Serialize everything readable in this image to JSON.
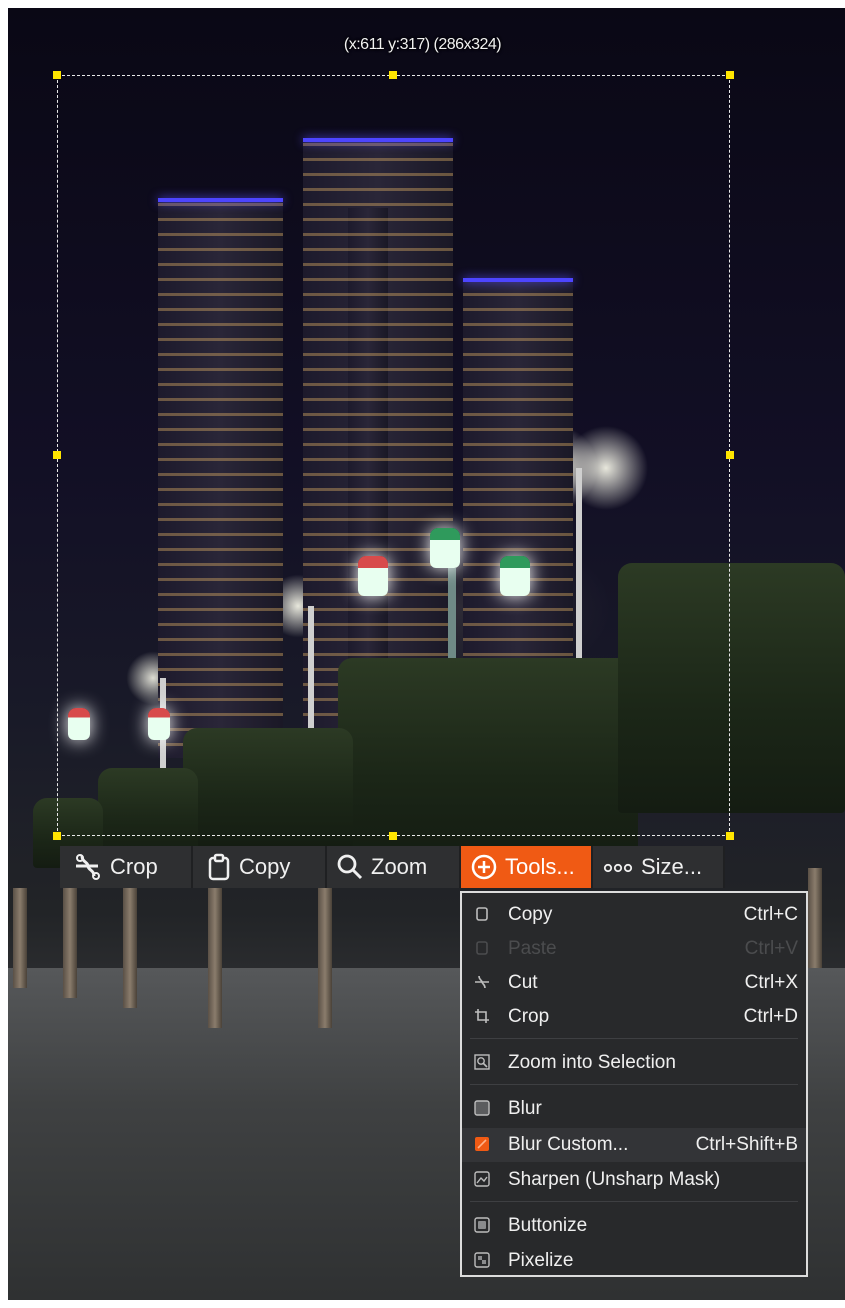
{
  "selection": {
    "readout": "(x:611 y:317) (286x324)"
  },
  "toolbar": {
    "crop_label": "Crop",
    "copy_label": "Copy",
    "zoom_label": "Zoom",
    "tools_label": "Tools...",
    "size_label": "Size...",
    "accent": "#f05a14"
  },
  "menu": {
    "items": [
      {
        "icon": "copy-icon",
        "label": "Copy",
        "shortcut": "Ctrl+C",
        "enabled": true
      },
      {
        "icon": "paste-icon",
        "label": "Paste",
        "shortcut": "Ctrl+V",
        "enabled": false
      },
      {
        "icon": "cut-icon",
        "label": "Cut",
        "shortcut": "Ctrl+X",
        "enabled": true
      },
      {
        "icon": "crop-icon",
        "label": "Crop",
        "shortcut": "Ctrl+D",
        "enabled": true
      },
      {
        "icon": "zoom-selection-icon",
        "label": "Zoom into Selection",
        "shortcut": "",
        "enabled": true
      },
      {
        "icon": "blur-icon",
        "label": "Blur",
        "shortcut": "",
        "enabled": true
      },
      {
        "icon": "blur-custom-icon",
        "label": "Blur Custom...",
        "shortcut": "Ctrl+Shift+B",
        "enabled": true,
        "highlighted": true
      },
      {
        "icon": "sharpen-icon",
        "label": "Sharpen (Unsharp Mask)",
        "shortcut": "",
        "enabled": true
      },
      {
        "icon": "buttonize-icon",
        "label": "Buttonize",
        "shortcut": "",
        "enabled": true
      },
      {
        "icon": "pixelize-icon",
        "label": "Pixelize",
        "shortcut": "",
        "enabled": true
      }
    ]
  }
}
